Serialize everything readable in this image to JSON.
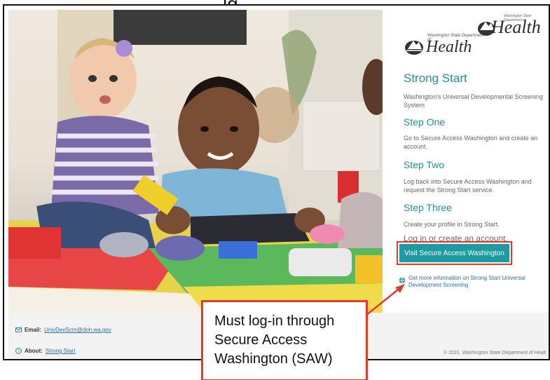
{
  "top_title_fragment": "lg",
  "logo": {
    "dept_small": "Washington State Department of",
    "word": "Health"
  },
  "panel": {
    "title": "Strong Start",
    "subtitle": "Washington's Universal Developmental Screening System",
    "step_one": {
      "heading": "Step One",
      "text": "Go to Secure Access Washington and create an account."
    },
    "step_two": {
      "heading": "Step Two",
      "text": "Log back into Secure Access Washington and request the Strong Start service."
    },
    "step_three": {
      "heading": "Step Three",
      "text": "Create your profile in Strong Start."
    },
    "login_prompt": "Log in or create an account,",
    "button_label": "Visit Secure Access Washington",
    "more_info_link": "Get more information on Strong Start Universal Development Screening"
  },
  "footer": {
    "email_label": "Email:",
    "email_value": "UnivDevScrn@doh.wa.gov",
    "about_label": "About:",
    "about_value": "Strong Start",
    "logo_small": "Washington State Department of",
    "logo_word": "Health",
    "copyright": "© 2021, Washington State Department of Healt"
  },
  "callout": {
    "text": "Must log-in through Secure Access Washington (SAW)"
  },
  "colors": {
    "accent_teal": "#2a8b9a",
    "button": "#1e9aa3",
    "link": "#2a6fb3",
    "annotation_red": "#e23b2a"
  },
  "icons": {
    "globe": "globe-icon",
    "email": "envelope-icon",
    "about": "help-circle-icon",
    "logo": "mountain-logo-icon"
  }
}
